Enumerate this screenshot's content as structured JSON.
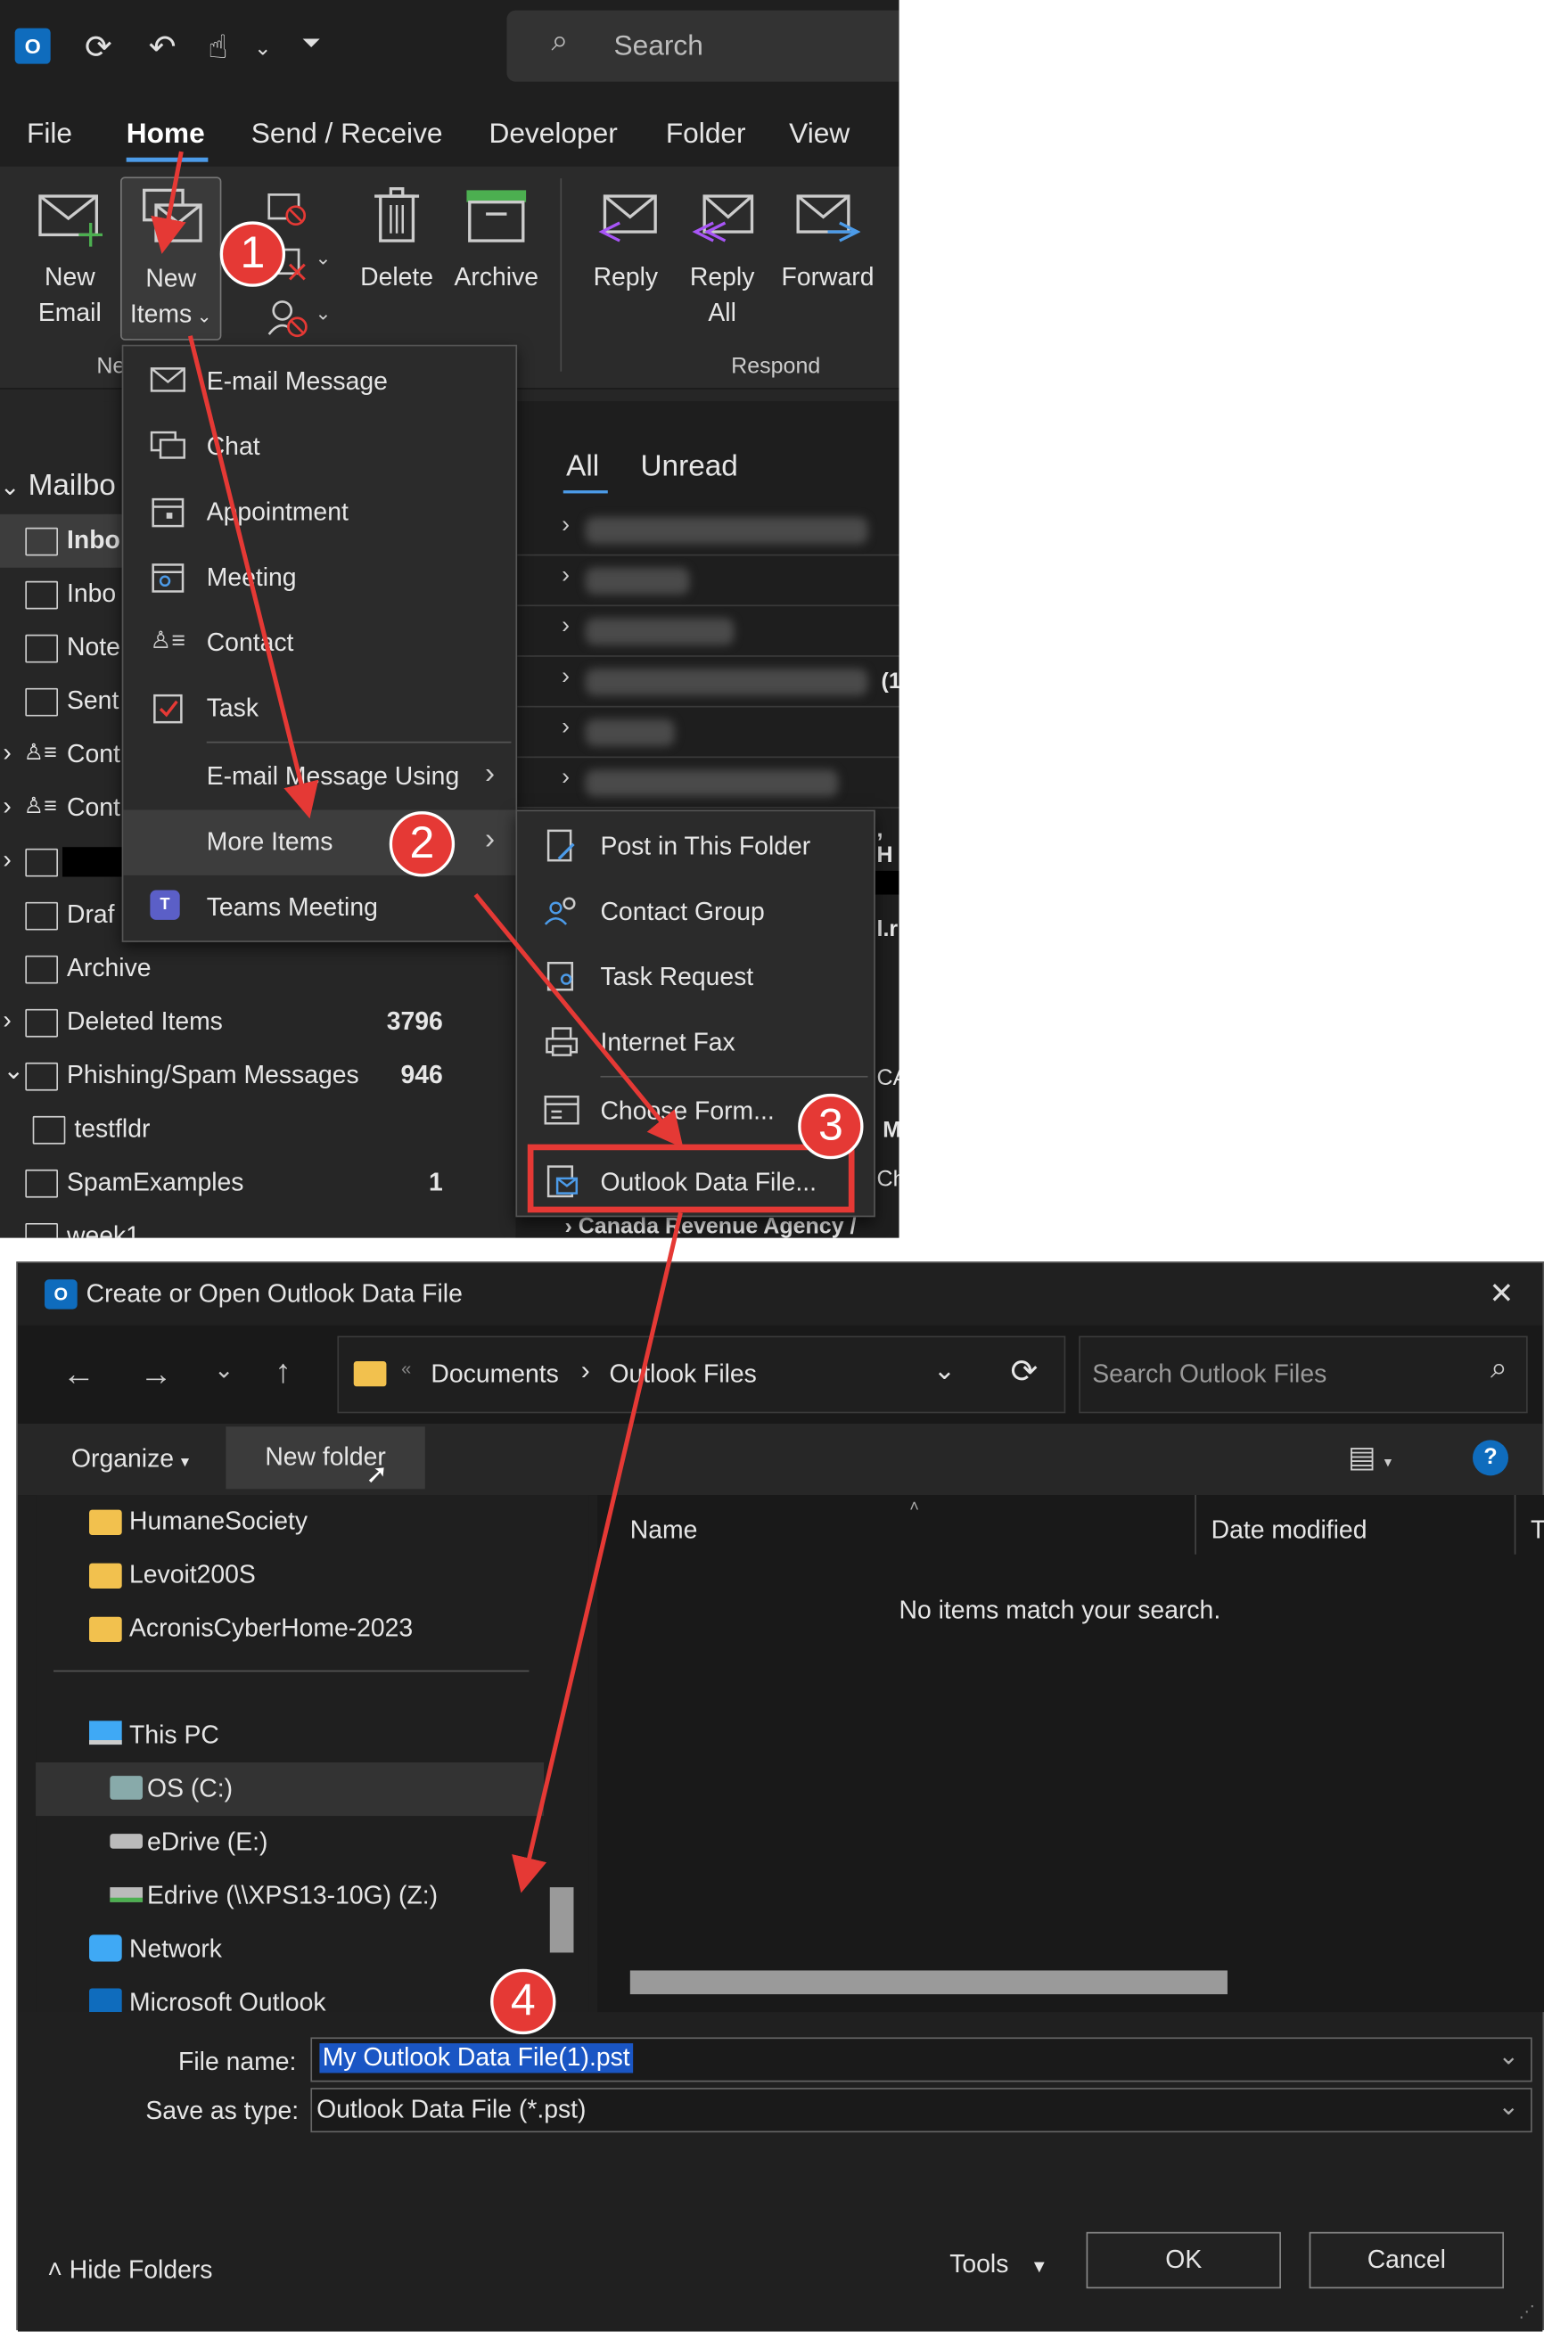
{
  "outlook": {
    "search_placeholder": "Search",
    "menu": [
      "File",
      "Home",
      "Send / Receive",
      "Developer",
      "Folder",
      "View"
    ],
    "ribbon": {
      "new_email": [
        "New",
        "Email"
      ],
      "new_items": [
        "New",
        "Items"
      ],
      "group_new_partial": "Ne",
      "delete": "Delete",
      "archive": "Archive",
      "reply": "Reply",
      "reply_all": [
        "Reply",
        "All"
      ],
      "forward": "Forward",
      "group_respond": "Respond"
    },
    "folders": {
      "mailbox": "Mailbo",
      "items": [
        {
          "label": "Inbo",
          "count": ""
        },
        {
          "label": "Inbo",
          "count": ""
        },
        {
          "label": "Note",
          "count": ""
        },
        {
          "label": "Sent",
          "count": ""
        },
        {
          "label": "Cont",
          "count": ""
        },
        {
          "label": "Cont",
          "count": ""
        },
        {
          "label": "",
          "count": ""
        },
        {
          "label": "Draf",
          "count": ""
        },
        {
          "label": "Archive",
          "count": ""
        },
        {
          "label": "Deleted Items",
          "count": "3796"
        },
        {
          "label": "Phishing/Spam Messages",
          "count": "946"
        },
        {
          "label": "testfldr",
          "count": ""
        },
        {
          "label": "SpamExamples",
          "count": "1"
        },
        {
          "label": "week1",
          "count": ""
        }
      ]
    },
    "mail_tabs": {
      "all": "All",
      "unread": "Unread"
    },
    "mail_fragments": [
      "(1",
      ", H",
      "l.r",
      "CA",
      "M",
      "Ch"
    ],
    "mail_bottom": "Canada Revenue Agency /",
    "new_items_menu": [
      "E-mail Message",
      "Chat",
      "Appointment",
      "Meeting",
      "Contact",
      "Task",
      "E-mail Message Using",
      "More Items",
      "Teams Meeting"
    ],
    "more_items_menu": [
      "Post in This Folder",
      "Contact Group",
      "Task Request",
      "Internet Fax",
      "Choose Form...",
      "Outlook Data File..."
    ],
    "steps": [
      "1",
      "2",
      "3",
      "4"
    ]
  },
  "dialog": {
    "title": "Create or Open Outlook Data File",
    "breadcrumb": [
      "Documents",
      "Outlook Files"
    ],
    "search_placeholder": "Search Outlook Files",
    "organize": "Organize",
    "new_folder": "New folder",
    "tree": [
      "HumaneSociety",
      "Levoit200S",
      "AcronisCyberHome-2023",
      "This PC",
      "OS (C:)",
      "eDrive (E:)",
      "Edrive (\\\\XPS13-10G) (Z:)",
      "Network",
      "Microsoft Outlook"
    ],
    "columns": {
      "name": "Name",
      "date": "Date modified",
      "type_partial": "T"
    },
    "empty_message": "No items match your search.",
    "file_name_label": "File name:",
    "file_name_value": "My Outlook Data File(1).pst",
    "save_type_label": "Save as type:",
    "save_type_value": "Outlook Data File (*.pst)",
    "hide_folders": "Hide Folders",
    "tools": "Tools",
    "ok": "OK",
    "cancel": "Cancel",
    "help": "?"
  },
  "colors": {
    "accent": "#0f6cbd",
    "annotation": "#e53935",
    "selection": "#1a56c4"
  }
}
